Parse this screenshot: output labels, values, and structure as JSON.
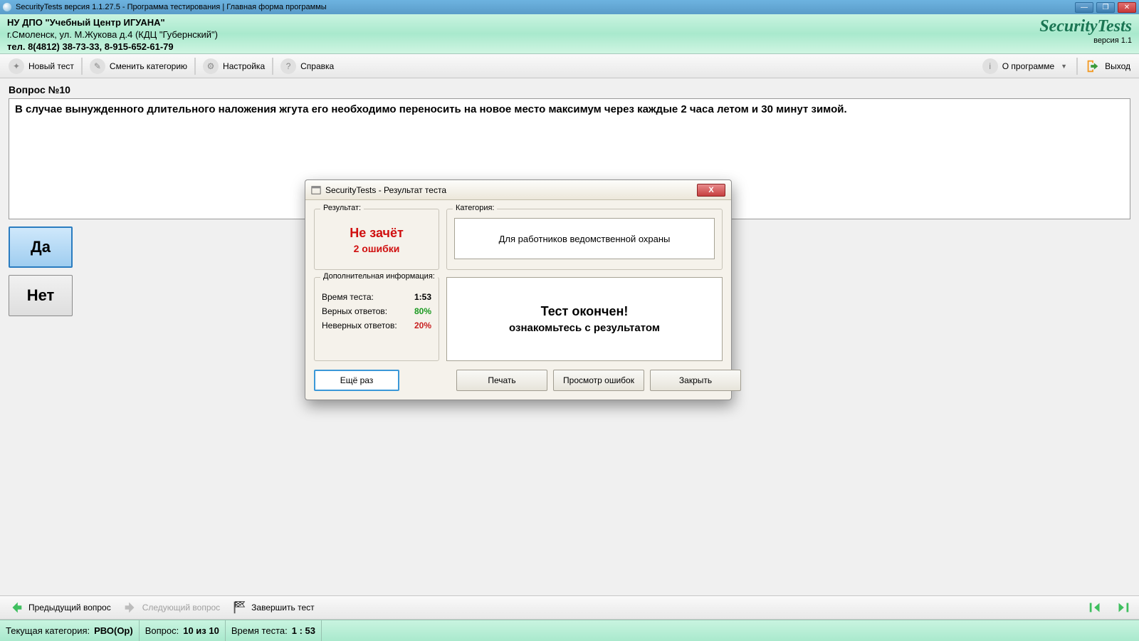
{
  "titlebar": {
    "text": "SecurityTests версия 1.1.27.5 - Программа тестирования | Главная форма программы"
  },
  "orghead": {
    "org": "НУ ДПО \"Учебный Центр ИГУАНА\"",
    "addr": "г.Смоленск, ул. М.Жукова д.4 (КДЦ \"Губернский\")",
    "tel": "тел. 8(4812) 38-73-33, 8-915-652-61-79",
    "logo": "SecurityTests",
    "version": "версия 1.1"
  },
  "toolbar": {
    "new_test": "Новый тест",
    "change_cat": "Сменить категорию",
    "settings": "Настройка",
    "help": "Справка",
    "about": "О программе",
    "exit": "Выход"
  },
  "question": {
    "label": "Вопрос №10",
    "text": "В случае вынужденного длительного наложения жгута его необходимо переносить на новое место максимум через каждые 2 часа летом и 30 минут зимой.",
    "yes": "Да",
    "no": "Нет"
  },
  "dialog": {
    "title": "SecurityTests - Результат теста",
    "result_legend": "Результат:",
    "verdict": "Не зачёт",
    "errors": "2 ошибки",
    "category_legend": "Категория:",
    "category": "Для работников ведомственной охраны",
    "info_legend": "Дополнительная информация:",
    "time_label": "Время теста:",
    "time_value": "1:53",
    "correct_label": "Верных ответов:",
    "correct_value": "80%",
    "wrong_label": "Неверных ответов:",
    "wrong_value": "20%",
    "finished1": "Тест окончен!",
    "finished2": "ознакомьтесь с результатом",
    "btn_again": "Ещё раз",
    "btn_print": "Печать",
    "btn_errors": "Просмотр ошибок",
    "btn_close": "Закрыть"
  },
  "navbar": {
    "prev": "Предыдущий вопрос",
    "next": "Следующий вопрос",
    "finish": "Завершить тест"
  },
  "status": {
    "cat_label": "Текущая категория:",
    "cat_value": "РВО(Ор)",
    "q_label": "Вопрос:",
    "q_value": "10 из 10",
    "time_label": "Время теста:",
    "time_value": "1 : 53"
  }
}
